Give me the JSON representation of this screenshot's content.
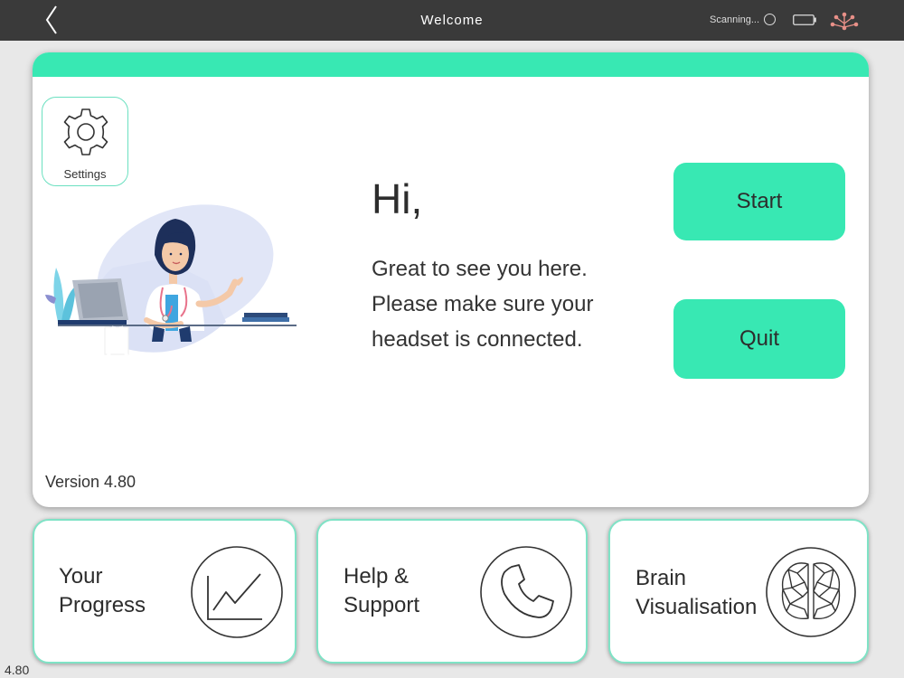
{
  "topbar": {
    "title": "Welcome",
    "scan_status": "Scanning...",
    "icons": [
      "back-chevron-icon",
      "scan-circle-icon",
      "battery-icon",
      "network-tree-icon"
    ]
  },
  "main": {
    "settings_label": "Settings",
    "greeting": "Hi,",
    "message_lines": [
      "Great to see you here.",
      "Please make sure your",
      "headset is connected."
    ],
    "start_label": "Start",
    "quit_label": "Quit",
    "version_label": "Version 4.80"
  },
  "tiles": [
    {
      "line1": "Your",
      "line2": "Progress",
      "icon": "chart-line-icon"
    },
    {
      "line1": "Help &",
      "line2": "Support",
      "icon": "phone-icon"
    },
    {
      "line1": "Brain",
      "line2": "Visualisation",
      "icon": "brain-icon"
    }
  ],
  "footer": {
    "version": "4.80"
  },
  "colors": {
    "accent": "#38e8b3",
    "topbar": "#3a3a3a",
    "background": "#e8e8e8",
    "tile_border": "#7fe3c6"
  }
}
